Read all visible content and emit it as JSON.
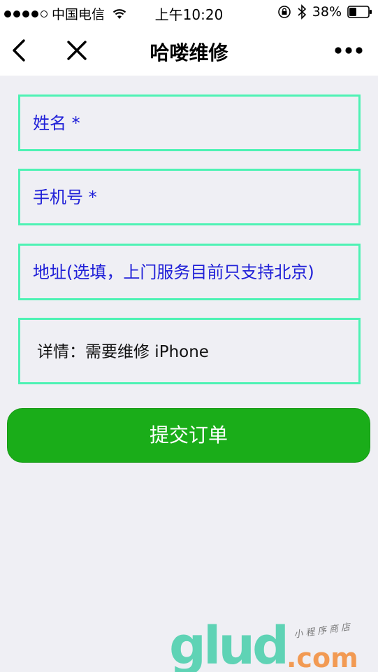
{
  "status_bar": {
    "carrier": "中国电信",
    "time": "上午10:20",
    "battery_percent": "38%",
    "battery_level": 0.38,
    "signal_bars_filled": 4,
    "signal_bars_total": 5
  },
  "nav": {
    "title": "哈喽维修",
    "back_icon": "chevron-left-icon",
    "close_icon": "close-icon",
    "more_icon": "more-horizontal-icon"
  },
  "form": {
    "name_placeholder": "姓名 *",
    "phone_placeholder": "手机号 *",
    "address_placeholder": "地址(选填，上门服务目前只支持北京)",
    "details_text": "详情：需要维修 iPhone",
    "submit_label": "提交订单"
  },
  "watermark": {
    "brand": "glud",
    "suffix": ".com",
    "tagline": "小程序商店"
  },
  "colors": {
    "background": "#efeff4",
    "field_border": "#4ef2b4",
    "placeholder_text": "#2020d8",
    "submit_button": "#1aad19",
    "watermark_teal": "#5fd3b5",
    "watermark_orange": "#f29a53"
  }
}
